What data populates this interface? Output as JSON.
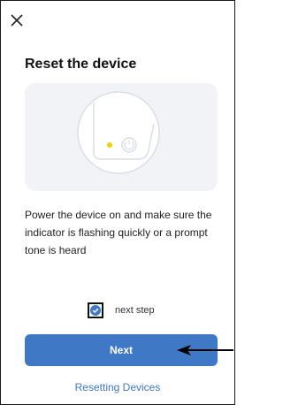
{
  "header": {
    "close_icon": "close-icon",
    "title": "Reset the device"
  },
  "illustration": {
    "icons": [
      "device-outline-icon",
      "indicator-dot-icon",
      "power-icon"
    ],
    "indicator_color": "#f5d000"
  },
  "instructions": "Power the device on and make sure the indicator is flashing quickly or a prompt tone is heard",
  "confirm": {
    "label": "next step",
    "checked": true,
    "icon": "checkmark-icon"
  },
  "actions": {
    "next_label": "Next",
    "link_label": "Resetting Devices"
  },
  "colors": {
    "accent": "#3f78c4",
    "illustration_bg": "#f1f3f7"
  }
}
